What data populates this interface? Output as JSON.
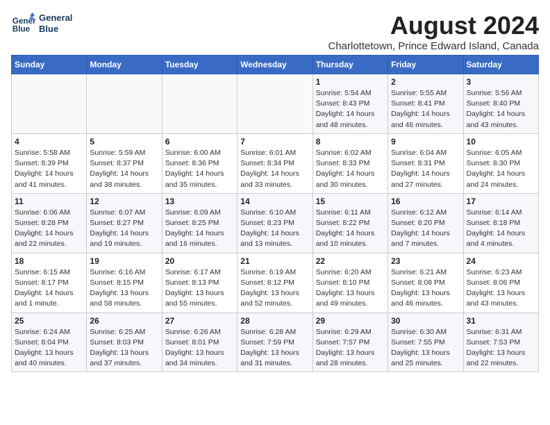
{
  "header": {
    "logo_line1": "General",
    "logo_line2": "Blue",
    "main_title": "August 2024",
    "subtitle": "Charlottetown, Prince Edward Island, Canada"
  },
  "weekdays": [
    "Sunday",
    "Monday",
    "Tuesday",
    "Wednesday",
    "Thursday",
    "Friday",
    "Saturday"
  ],
  "weeks": [
    [
      {
        "day": "",
        "info": ""
      },
      {
        "day": "",
        "info": ""
      },
      {
        "day": "",
        "info": ""
      },
      {
        "day": "",
        "info": ""
      },
      {
        "day": "1",
        "info": "Sunrise: 5:54 AM\nSunset: 8:43 PM\nDaylight: 14 hours\nand 48 minutes."
      },
      {
        "day": "2",
        "info": "Sunrise: 5:55 AM\nSunset: 8:41 PM\nDaylight: 14 hours\nand 46 minutes."
      },
      {
        "day": "3",
        "info": "Sunrise: 5:56 AM\nSunset: 8:40 PM\nDaylight: 14 hours\nand 43 minutes."
      }
    ],
    [
      {
        "day": "4",
        "info": "Sunrise: 5:58 AM\nSunset: 8:39 PM\nDaylight: 14 hours\nand 41 minutes."
      },
      {
        "day": "5",
        "info": "Sunrise: 5:59 AM\nSunset: 8:37 PM\nDaylight: 14 hours\nand 38 minutes."
      },
      {
        "day": "6",
        "info": "Sunrise: 6:00 AM\nSunset: 8:36 PM\nDaylight: 14 hours\nand 35 minutes."
      },
      {
        "day": "7",
        "info": "Sunrise: 6:01 AM\nSunset: 8:34 PM\nDaylight: 14 hours\nand 33 minutes."
      },
      {
        "day": "8",
        "info": "Sunrise: 6:02 AM\nSunset: 8:33 PM\nDaylight: 14 hours\nand 30 minutes."
      },
      {
        "day": "9",
        "info": "Sunrise: 6:04 AM\nSunset: 8:31 PM\nDaylight: 14 hours\nand 27 minutes."
      },
      {
        "day": "10",
        "info": "Sunrise: 6:05 AM\nSunset: 8:30 PM\nDaylight: 14 hours\nand 24 minutes."
      }
    ],
    [
      {
        "day": "11",
        "info": "Sunrise: 6:06 AM\nSunset: 8:28 PM\nDaylight: 14 hours\nand 22 minutes."
      },
      {
        "day": "12",
        "info": "Sunrise: 6:07 AM\nSunset: 8:27 PM\nDaylight: 14 hours\nand 19 minutes."
      },
      {
        "day": "13",
        "info": "Sunrise: 6:09 AM\nSunset: 8:25 PM\nDaylight: 14 hours\nand 16 minutes."
      },
      {
        "day": "14",
        "info": "Sunrise: 6:10 AM\nSunset: 8:23 PM\nDaylight: 14 hours\nand 13 minutes."
      },
      {
        "day": "15",
        "info": "Sunrise: 6:11 AM\nSunset: 8:22 PM\nDaylight: 14 hours\nand 10 minutes."
      },
      {
        "day": "16",
        "info": "Sunrise: 6:12 AM\nSunset: 8:20 PM\nDaylight: 14 hours\nand 7 minutes."
      },
      {
        "day": "17",
        "info": "Sunrise: 6:14 AM\nSunset: 8:18 PM\nDaylight: 14 hours\nand 4 minutes."
      }
    ],
    [
      {
        "day": "18",
        "info": "Sunrise: 6:15 AM\nSunset: 8:17 PM\nDaylight: 14 hours\nand 1 minute."
      },
      {
        "day": "19",
        "info": "Sunrise: 6:16 AM\nSunset: 8:15 PM\nDaylight: 13 hours\nand 58 minutes."
      },
      {
        "day": "20",
        "info": "Sunrise: 6:17 AM\nSunset: 8:13 PM\nDaylight: 13 hours\nand 55 minutes."
      },
      {
        "day": "21",
        "info": "Sunrise: 6:19 AM\nSunset: 8:12 PM\nDaylight: 13 hours\nand 52 minutes."
      },
      {
        "day": "22",
        "info": "Sunrise: 6:20 AM\nSunset: 8:10 PM\nDaylight: 13 hours\nand 49 minutes."
      },
      {
        "day": "23",
        "info": "Sunrise: 6:21 AM\nSunset: 8:08 PM\nDaylight: 13 hours\nand 46 minutes."
      },
      {
        "day": "24",
        "info": "Sunrise: 6:23 AM\nSunset: 8:06 PM\nDaylight: 13 hours\nand 43 minutes."
      }
    ],
    [
      {
        "day": "25",
        "info": "Sunrise: 6:24 AM\nSunset: 8:04 PM\nDaylight: 13 hours\nand 40 minutes."
      },
      {
        "day": "26",
        "info": "Sunrise: 6:25 AM\nSunset: 8:03 PM\nDaylight: 13 hours\nand 37 minutes."
      },
      {
        "day": "27",
        "info": "Sunrise: 6:26 AM\nSunset: 8:01 PM\nDaylight: 13 hours\nand 34 minutes."
      },
      {
        "day": "28",
        "info": "Sunrise: 6:28 AM\nSunset: 7:59 PM\nDaylight: 13 hours\nand 31 minutes."
      },
      {
        "day": "29",
        "info": "Sunrise: 6:29 AM\nSunset: 7:57 PM\nDaylight: 13 hours\nand 28 minutes."
      },
      {
        "day": "30",
        "info": "Sunrise: 6:30 AM\nSunset: 7:55 PM\nDaylight: 13 hours\nand 25 minutes."
      },
      {
        "day": "31",
        "info": "Sunrise: 6:31 AM\nSunset: 7:53 PM\nDaylight: 13 hours\nand 22 minutes."
      }
    ]
  ]
}
